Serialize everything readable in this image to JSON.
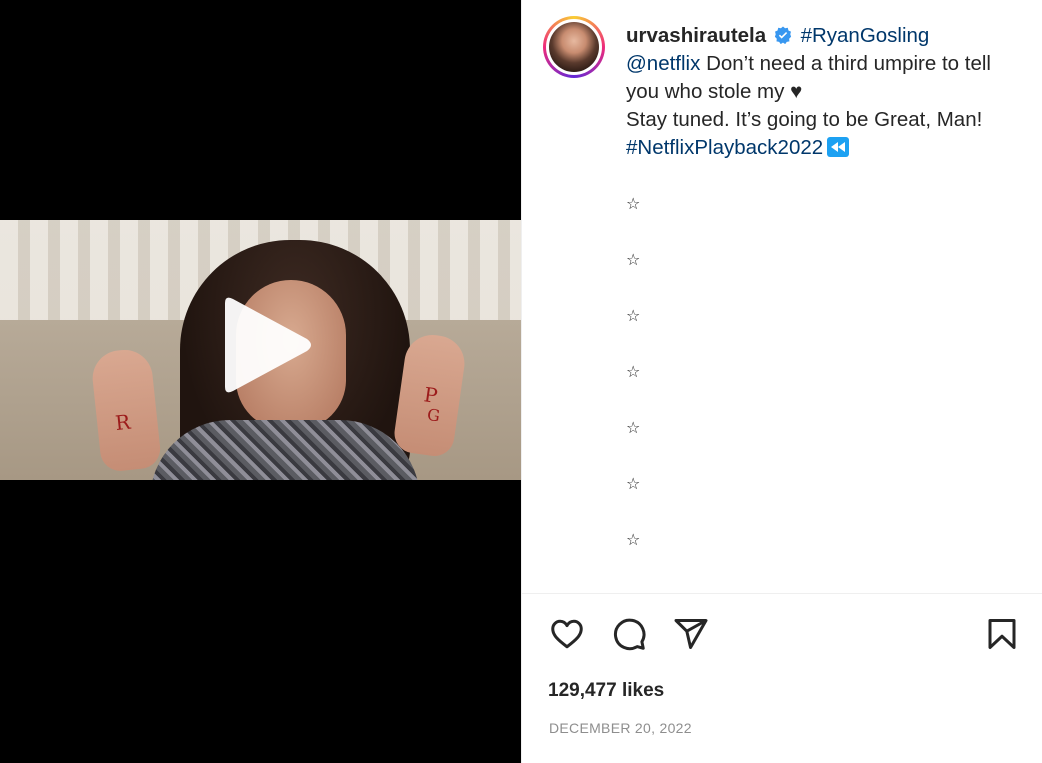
{
  "post": {
    "username": "urvashirautela",
    "verified_icon": "verified-badge-icon",
    "caption_parts": {
      "hashtag_1": "#RyanGosling",
      "mention": "@netflix",
      "text_1": " Don’t need a third umpire to tell you who stole my ",
      "heart_glyph": "♥",
      "text_2": "Stay tuned. It’s going to be Great, Man! ",
      "hashtag_2": "#NetflixPlayback2022",
      "rewind_icon": "rewind-emoji-icon"
    },
    "stars": [
      "☆",
      "☆",
      "☆",
      "☆",
      "☆",
      "☆",
      "☆"
    ],
    "likes": "129,477 likes",
    "date": "DECEMBER 20, 2022"
  },
  "media": {
    "play_icon": "play-icon",
    "hand_letters": {
      "left": "R",
      "right_top": "P",
      "right_bottom": "G"
    }
  },
  "actions": {
    "like_icon": "heart-icon",
    "comment_icon": "comment-icon",
    "share_icon": "share-icon",
    "save_icon": "bookmark-icon"
  },
  "colors": {
    "text": "#262626",
    "link": "#00376b",
    "muted": "#8e8e8e",
    "verified": "#3897f0",
    "media_bg": "#000000"
  }
}
